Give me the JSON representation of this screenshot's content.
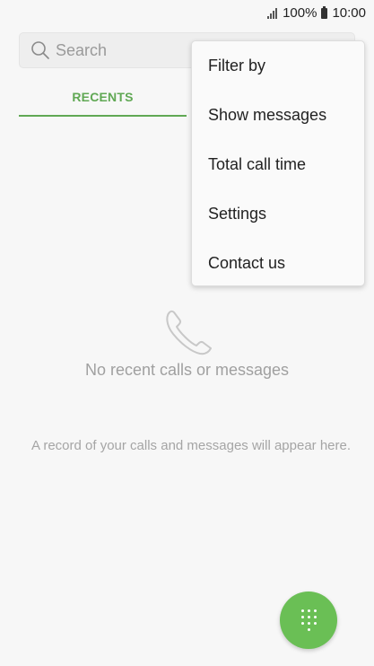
{
  "status_bar": {
    "battery_percent": "100%",
    "time": "10:00",
    "icons": [
      "signal-icon",
      "battery-icon"
    ]
  },
  "search": {
    "placeholder": "Search",
    "icon": "search-icon"
  },
  "tabs": [
    {
      "label": "RECENTS",
      "selected": true
    }
  ],
  "overflow_menu": {
    "items": [
      {
        "label": "Filter by"
      },
      {
        "label": "Show messages"
      },
      {
        "label": "Total call time"
      },
      {
        "label": "Settings"
      },
      {
        "label": "Contact us"
      }
    ]
  },
  "empty_state": {
    "icon": "phone-icon",
    "title": "No recent calls or messages",
    "description": "A record of your calls and messages will appear here."
  },
  "fab": {
    "icon": "dialpad-icon"
  },
  "colors": {
    "accent": "#60a854",
    "fab": "#6abf55",
    "background": "#f7f7f7"
  }
}
